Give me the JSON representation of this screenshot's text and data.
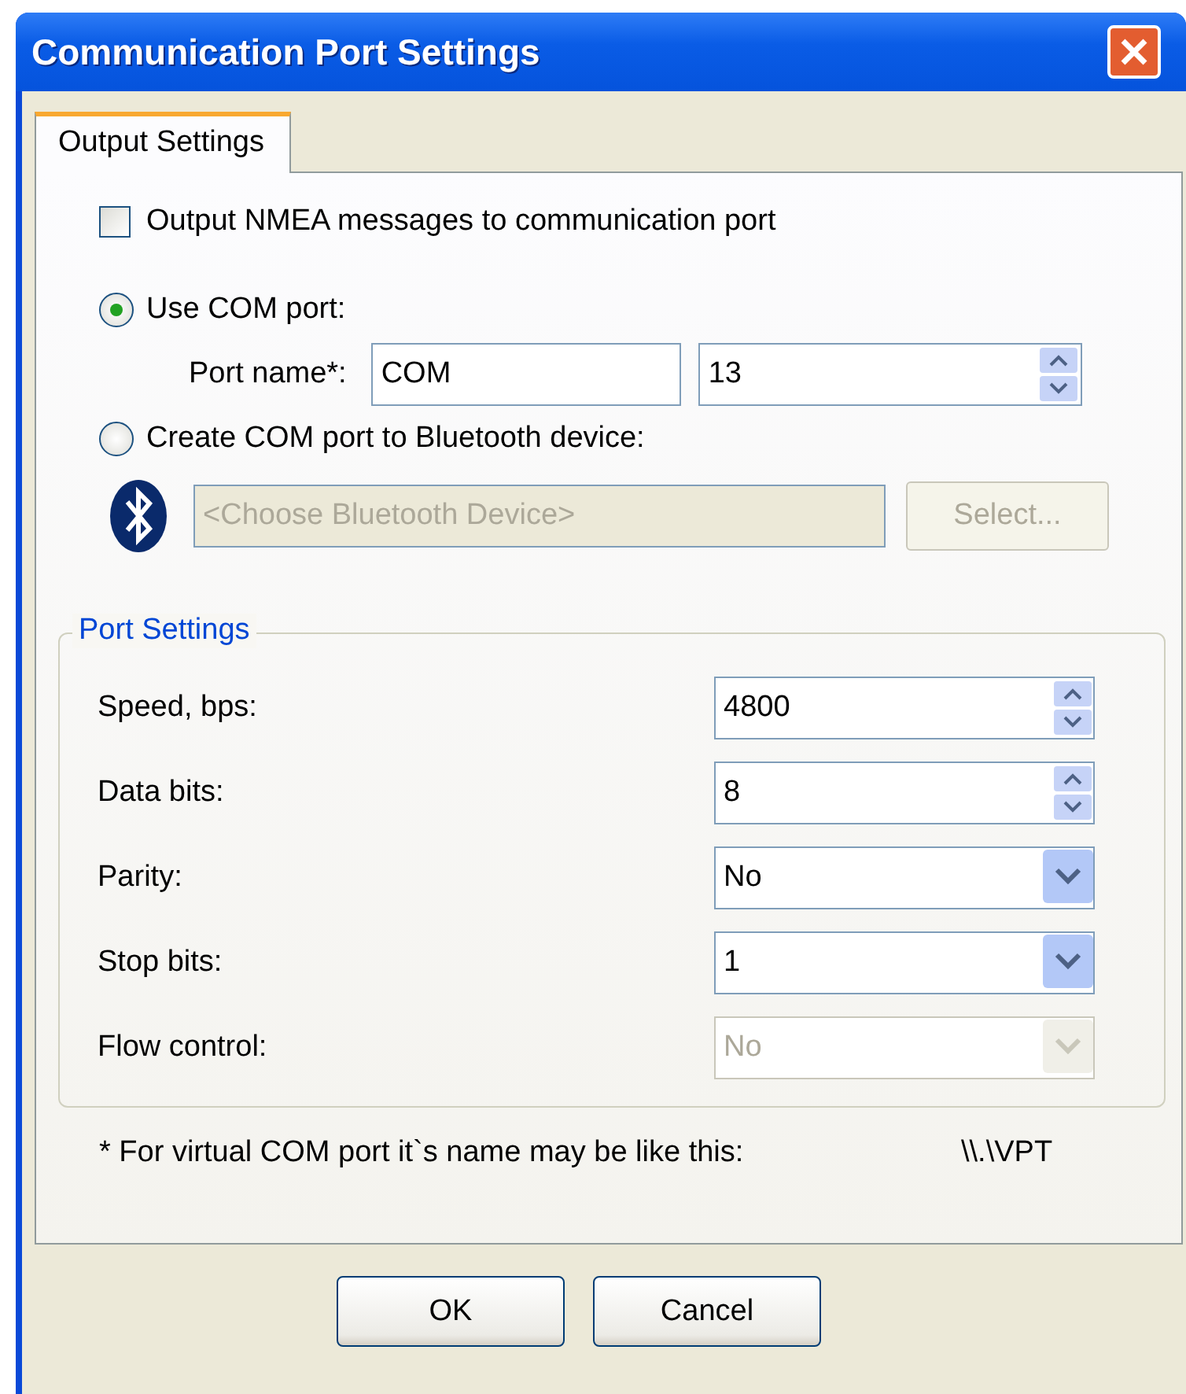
{
  "window": {
    "title": "Communication Port Settings"
  },
  "tabs": [
    {
      "label": "Output Settings",
      "selected": true
    }
  ],
  "output_nmea": {
    "label": "Output NMEA messages to communication port",
    "checked": false
  },
  "port_options": [
    {
      "label": "Use COM port:",
      "selected": true
    },
    {
      "label": "Create COM port to Bluetooth device:",
      "selected": false
    }
  ],
  "com_port": {
    "label": "Port name*:",
    "name": "COM",
    "number": "13"
  },
  "bluetooth": {
    "placeholder": "<Choose Bluetooth Device>",
    "disabled": true,
    "button": "Select...",
    "button_disabled": true
  },
  "port_settings": {
    "title": "Port Settings",
    "rows": [
      {
        "label": "Speed, bps:",
        "value": "4800",
        "kind": "spin",
        "disabled": false
      },
      {
        "label": "Data bits:",
        "value": "8",
        "kind": "spin",
        "disabled": false
      },
      {
        "label": "Parity:",
        "value": "No",
        "kind": "dropdown",
        "disabled": false
      },
      {
        "label": "Stop bits:",
        "value": "1",
        "kind": "dropdown",
        "disabled": false
      },
      {
        "label": "Flow control:",
        "value": "No",
        "kind": "dropdown",
        "disabled": true
      }
    ]
  },
  "footnote": {
    "text": "* For virtual COM port it`s name may be like this:",
    "example": "\\\\.\\VPT"
  },
  "buttons": [
    "OK",
    "Cancel"
  ]
}
